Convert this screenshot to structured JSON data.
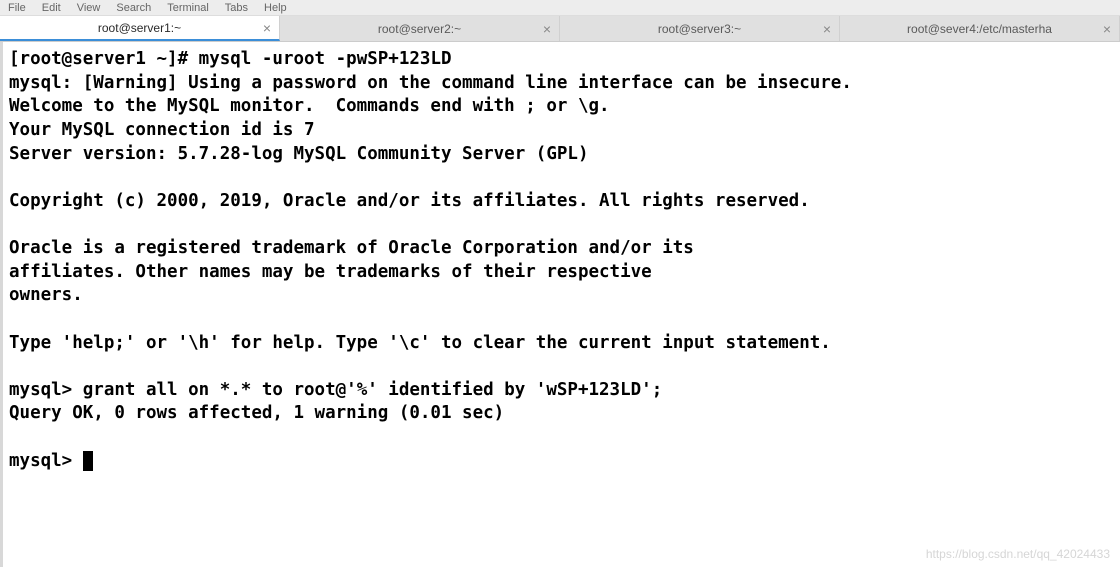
{
  "menubar": {
    "items": [
      "File",
      "Edit",
      "View",
      "Search",
      "Terminal",
      "Tabs",
      "Help"
    ]
  },
  "tabs": [
    {
      "label": "root@server1:~",
      "active": true
    },
    {
      "label": "root@server2:~",
      "active": false
    },
    {
      "label": "root@server3:~",
      "active": false
    },
    {
      "label": "root@sever4:/etc/masterha",
      "active": false
    }
  ],
  "terminal": {
    "prompt1": "[root@server1 ~]# ",
    "command1": "mysql -uroot -pwSP+123LD",
    "body": "mysql: [Warning] Using a password on the command line interface can be insecure.\nWelcome to the MySQL monitor.  Commands end with ; or \\g.\nYour MySQL connection id is 7\nServer version: 5.7.28-log MySQL Community Server (GPL)\n\nCopyright (c) 2000, 2019, Oracle and/or its affiliates. All rights reserved.\n\nOracle is a registered trademark of Oracle Corporation and/or its\naffiliates. Other names may be trademarks of their respective\nowners.\n\nType 'help;' or '\\h' for help. Type '\\c' to clear the current input statement.\n",
    "prompt2": "mysql> ",
    "command2": "grant all on *.* to root@'%' identified by 'wSP+123LD';",
    "result": "Query OK, 0 rows affected, 1 warning (0.01 sec)\n",
    "prompt3": "mysql> "
  },
  "watermark": "https://blog.csdn.net/qq_42024433"
}
